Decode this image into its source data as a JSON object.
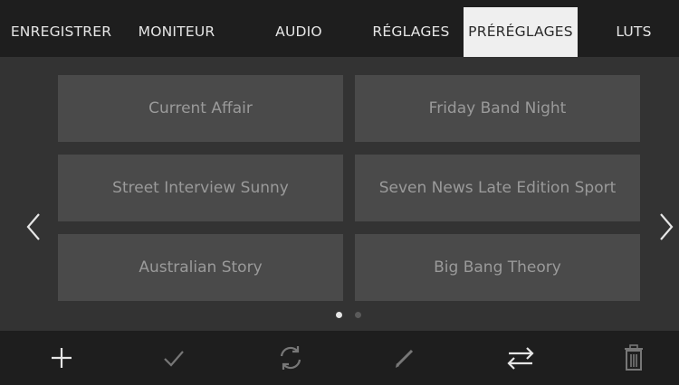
{
  "tabs": [
    {
      "label": "ENREGISTRER",
      "active": false
    },
    {
      "label": "MONITEUR",
      "active": false
    },
    {
      "label": "AUDIO",
      "active": false
    },
    {
      "label": "RÉGLAGES",
      "active": false
    },
    {
      "label": "PRÉRÉGLAGES",
      "active": true
    },
    {
      "label": "LUTS",
      "active": false
    }
  ],
  "presets": [
    "Current Affair",
    "Friday Band Night",
    "Street Interview Sunny",
    "Seven News Late Edition Sport",
    "Australian Story",
    "Big Bang Theory"
  ],
  "pagination": {
    "current_page": 1,
    "total_pages": 2
  },
  "navigation": {
    "prev_icon": "chevron-left-icon",
    "next_icon": "chevron-right-icon"
  },
  "toolbar": [
    {
      "icon": "plus-icon",
      "action": "add"
    },
    {
      "icon": "check-icon",
      "action": "load"
    },
    {
      "icon": "refresh-icon",
      "action": "update"
    },
    {
      "icon": "pencil-icon",
      "action": "rename"
    },
    {
      "icon": "transfer-icon",
      "action": "import-export"
    },
    {
      "icon": "trash-icon",
      "action": "delete"
    }
  ],
  "colors": {
    "background": "#333333",
    "bar_background": "#1e1e1e",
    "tile_background": "#4a4a4a",
    "tile_text": "#9a9a9a",
    "active_tab_background": "#efefef",
    "icon_bright": "#e6e6e6",
    "icon_dim": "#777777"
  }
}
